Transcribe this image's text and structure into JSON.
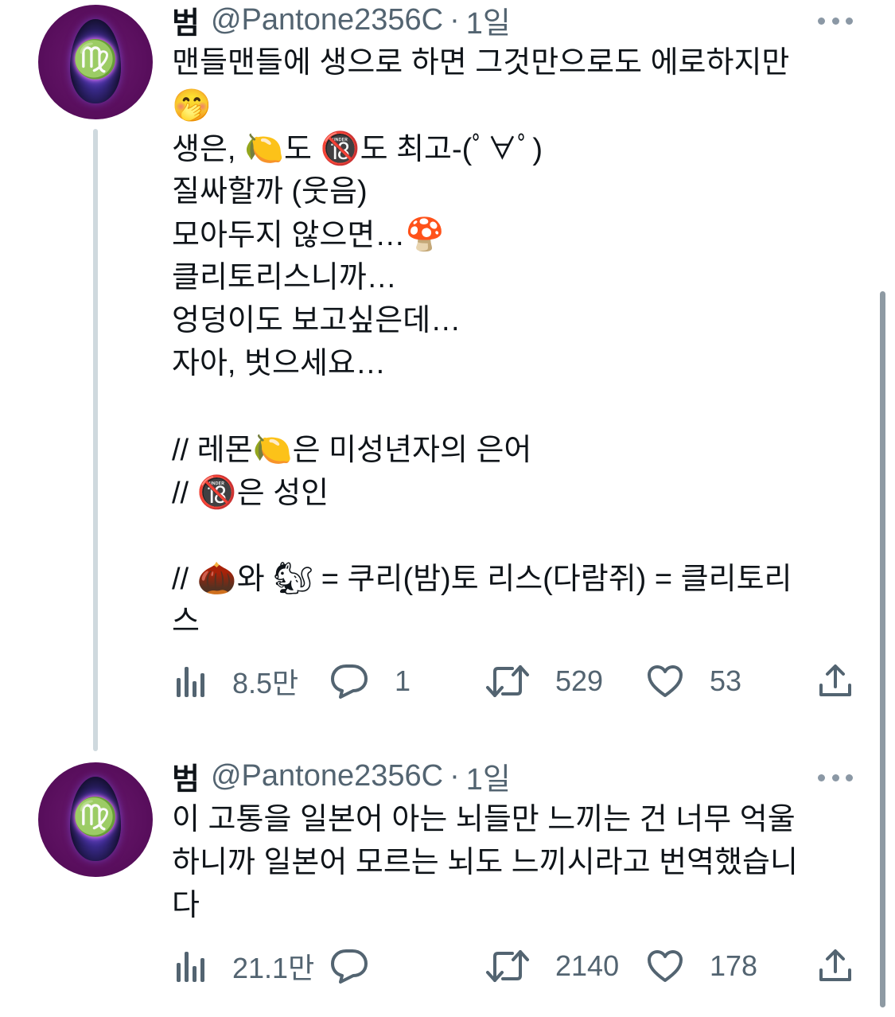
{
  "tweets": [
    {
      "display_name": "범",
      "handle": "@Pantone2356C",
      "separator": "·",
      "time": "1일",
      "lines": [
        "맨들맨들에 생으로 하면 그것만으로도 에로하지만",
        "",
        "생은, ",
        "도 ",
        "도 최고-(ﾟ∀ﾟ)",
        "질싸할까 (웃음)",
        "모아두지 않으면…",
        "클리토리스니까…",
        "엉덩이도 보고싶은데…",
        "자아, 벗으세요…",
        "// 레몬",
        "은 미성년자의 은어",
        "// ",
        "은 성인",
        "// ",
        "와 ",
        " = 쿠리(밤)토 리스(다람쥐) = 클리토리",
        "스"
      ],
      "emojis": {
        "face": "🤭",
        "lemon": "🍋",
        "no18": "🔞",
        "mushroom": "🍄",
        "chestnut": "🌰",
        "chipmunk": "🐿"
      },
      "stats": {
        "views": "8.5만",
        "replies": "1",
        "retweets": "529",
        "likes": "53"
      }
    },
    {
      "display_name": "범",
      "handle": "@Pantone2356C",
      "separator": "·",
      "time": "1일",
      "lines": [
        "이 고통을 일본어 아는 뇌들만 느끼는 건 너무 억울",
        "하니까 일본어 모르는 뇌도 느끼시라고 번역했습니",
        "다"
      ],
      "stats": {
        "views": "21.1만",
        "replies": "",
        "retweets": "2140",
        "likes": "178"
      }
    }
  ],
  "icons": {
    "avatar_glyph": "♍",
    "more": "more-dots-icon",
    "views": "bar-chart-icon",
    "reply": "speech-bubble-icon",
    "retweet": "retweet-icon",
    "like": "heart-icon",
    "share": "share-upload-icon"
  },
  "colors": {
    "text": "#0f1419",
    "secondary": "#536471",
    "thread_line": "#cfd9de",
    "avatar_bg": "#5a0f5e"
  }
}
